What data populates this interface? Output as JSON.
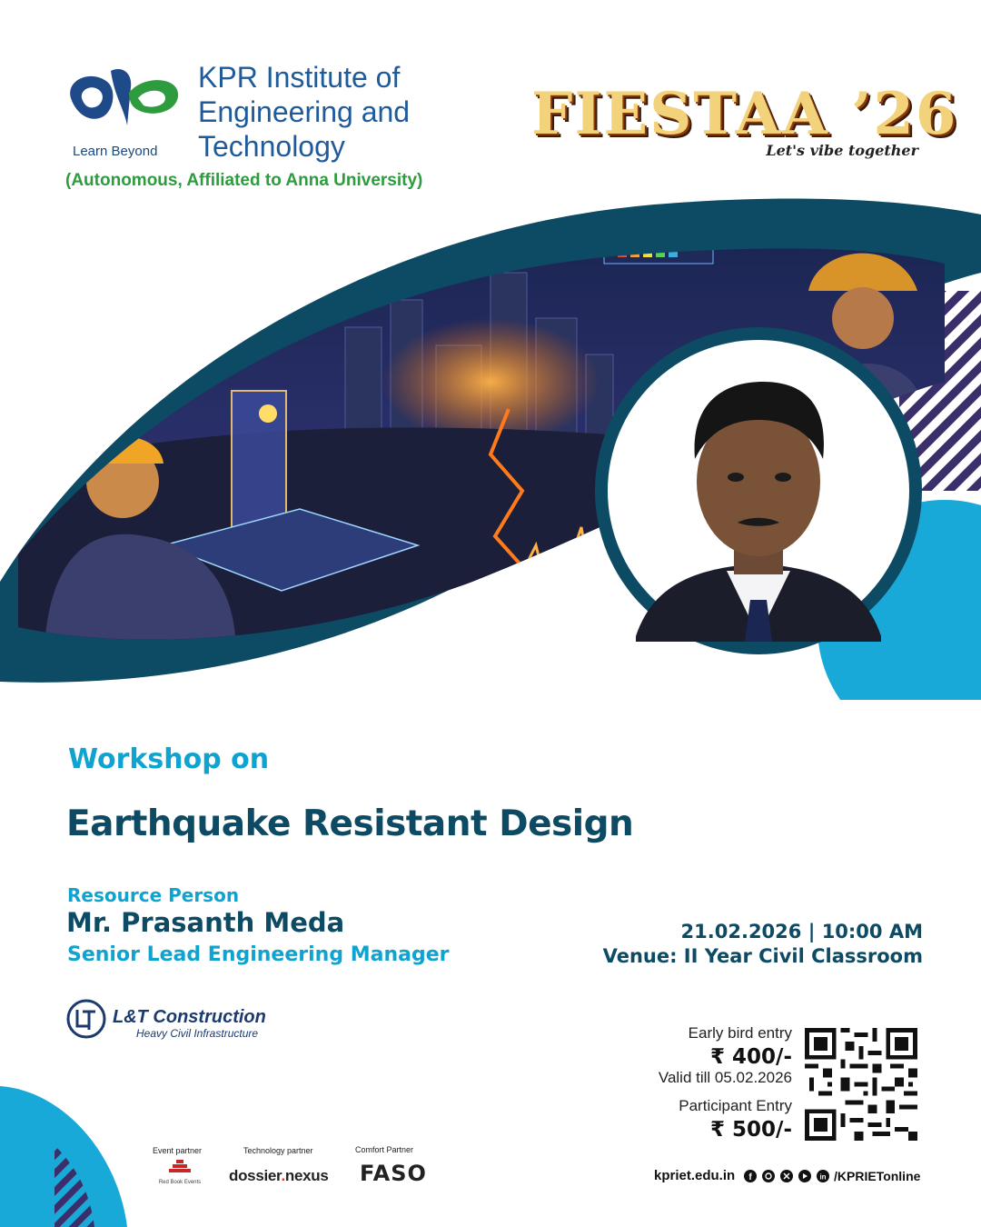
{
  "header": {
    "institute_name": "KPR Institute of Engineering and Technology",
    "tagline": "Learn Beyond",
    "affiliation": "(Autonomous, Affiliated to Anna University)"
  },
  "event": {
    "title": "FIESTAA ’26",
    "slogan": "Let's vibe together"
  },
  "workshop": {
    "label": "Workshop on",
    "title": "Earthquake Resistant Design"
  },
  "resource_person": {
    "label": "Resource Person",
    "name": "Mr. Prasanth Meda",
    "role": "Senior Lead Engineering Manager"
  },
  "schedule": {
    "date_time": "21.02.2026 | 10:00 AM",
    "venue": "Venue: II Year Civil Classroom"
  },
  "company": {
    "name": "L&T Construction",
    "division": "Heavy Civil Infrastructure"
  },
  "pricing": {
    "early_label": "Early bird entry",
    "early_value": "₹ 400/-",
    "valid_till": "Valid till 05.02.2026",
    "participant_label": "Participant Entry",
    "participant_value": "₹ 500/-"
  },
  "partners": {
    "event_label": "Event partner",
    "tech_label": "Technology partner",
    "comfort_label": "Comfort Partner",
    "event_name": "Red Book Events",
    "tech_name_a": "dossier",
    "tech_name_dot": ".",
    "tech_name_b": "nexus",
    "comfort_name": "FASO"
  },
  "footer": {
    "website": "kpriet.edu.in",
    "handle": "/KPRIETonline",
    "social_icons": [
      "facebook-icon",
      "instagram-icon",
      "x-icon",
      "youtube-icon",
      "linkedin-icon"
    ]
  },
  "colors": {
    "navy": "#0d4a63",
    "cyan": "#0fa3d0",
    "green": "#2e9b3e",
    "blue": "#1f5a9a"
  }
}
